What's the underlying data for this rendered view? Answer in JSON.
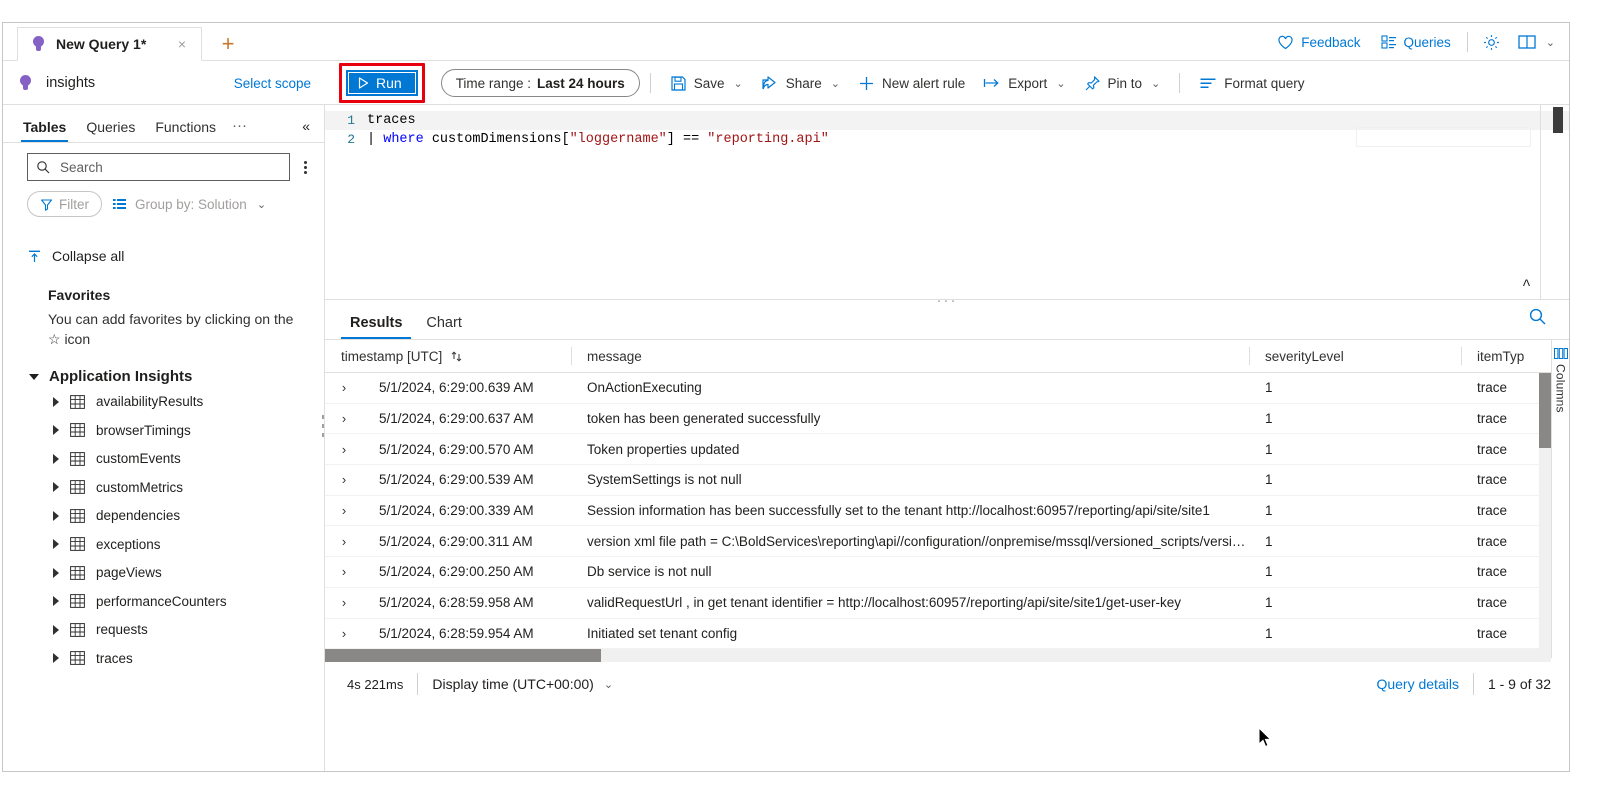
{
  "tab": {
    "title": "New Query 1*",
    "close_label": "×",
    "add_label": "+",
    "icon": "lightbulb-icon"
  },
  "header_right": {
    "feedback": "Feedback",
    "queries": "Queries",
    "settings_icon": "gear-icon",
    "layout_icon": "book-layout-icon",
    "layout_chevron": "⌄"
  },
  "scope": {
    "name": "insights",
    "select_scope": "Select scope",
    "icon": "lightbulb-icon"
  },
  "commandbar": {
    "run": "Run",
    "run_icon": "play-icon",
    "time_range_label": "Time range :",
    "time_range_value": "Last 24 hours",
    "save": "Save",
    "share": "Share",
    "new_alert_rule": "New alert rule",
    "export": "Export",
    "pin_to": "Pin to",
    "format_query": "Format query",
    "chevron": "⌄"
  },
  "left_panel": {
    "tabs": [
      {
        "label": "Tables",
        "active": true
      },
      {
        "label": "Queries",
        "active": false
      },
      {
        "label": "Functions",
        "active": false
      }
    ],
    "more_label": "···",
    "collapse_icon": "«",
    "search_placeholder": "Search",
    "search_value": "",
    "search_icon": "search-icon",
    "kebab_icon": "more-vertical-icon",
    "filter_label": "Filter",
    "filter_icon": "funnel-icon",
    "group_by_label": "Group by: Solution",
    "group_by_icon": "list-icon",
    "collapse_all": "Collapse all",
    "collapse_all_icon": "collapse-all-icon",
    "favorites_title": "Favorites",
    "favorites_hint": "You can add favorites by clicking on the ☆ icon",
    "group_title": "Application Insights",
    "tables": [
      "availabilityResults",
      "browserTimings",
      "customEvents",
      "customMetrics",
      "dependencies",
      "exceptions",
      "pageViews",
      "performanceCounters",
      "requests",
      "traces"
    ]
  },
  "editor": {
    "lines": [
      {
        "number": "1",
        "text": "traces"
      },
      {
        "number": "2",
        "text": "| where customDimensions[\"loggername\"] == \"reporting.api\""
      }
    ],
    "line2_tokens": {
      "pipe": "|",
      "keyword": "where",
      "identifier": " customDimensions[",
      "string1": "\"loggername\"",
      "bracket": "] ",
      "operator": "==",
      "string2": " \"reporting.api\""
    },
    "collapse_chevrons": "«"
  },
  "results": {
    "tabs": [
      {
        "label": "Results",
        "active": true
      },
      {
        "label": "Chart",
        "active": false
      }
    ],
    "search_icon": "search-icon",
    "columns_rail_label": "Columns",
    "columns_rail_icon": "columns-icon",
    "headers": [
      {
        "label": "timestamp [UTC]",
        "sort_icon": "sort-updown-icon"
      },
      {
        "label": "message",
        "sort_icon": ""
      },
      {
        "label": "severityLevel",
        "sort_icon": ""
      },
      {
        "label": "itemTyp",
        "sort_icon": ""
      }
    ],
    "expand_icon": "›",
    "rows": [
      {
        "timestamp": "5/1/2024, 6:29:00.639 AM",
        "message": "OnActionExecuting",
        "severityLevel": "1",
        "itemType": "trace"
      },
      {
        "timestamp": "5/1/2024, 6:29:00.637 AM",
        "message": "token has been generated successfully",
        "severityLevel": "1",
        "itemType": "trace"
      },
      {
        "timestamp": "5/1/2024, 6:29:00.570 AM",
        "message": "Token properties updated",
        "severityLevel": "1",
        "itemType": "trace"
      },
      {
        "timestamp": "5/1/2024, 6:29:00.539 AM",
        "message": "SystemSettings is not null",
        "severityLevel": "1",
        "itemType": "trace"
      },
      {
        "timestamp": "5/1/2024, 6:29:00.339 AM",
        "message": "Session information has been successfully set to the tenant http://localhost:60957/reporting/api/site/site1",
        "severityLevel": "1",
        "itemType": "trace"
      },
      {
        "timestamp": "5/1/2024, 6:29:00.311 AM",
        "message": "version xml file path = C:\\BoldServices\\reporting\\api//configuration//onpremise/mssql/versioned_scripts/versio…",
        "severityLevel": "1",
        "itemType": "trace"
      },
      {
        "timestamp": "5/1/2024, 6:29:00.250 AM",
        "message": "Db service is not null",
        "severityLevel": "1",
        "itemType": "trace"
      },
      {
        "timestamp": "5/1/2024, 6:28:59.958 AM",
        "message": "validRequestUrl , in get tenant identifier = http://localhost:60957/reporting/api/site/site1/get-user-key",
        "severityLevel": "1",
        "itemType": "trace"
      },
      {
        "timestamp": "5/1/2024, 6:28:59.954 AM",
        "message": "Initiated set tenant config",
        "severityLevel": "1",
        "itemType": "trace"
      }
    ]
  },
  "statusbar": {
    "duration": "4s 221ms",
    "display_time": "Display time (UTC+00:00)",
    "display_time_chevron": "⌄",
    "query_details": "Query details",
    "page_count": "1 - 9 of 32"
  },
  "colors": {
    "accent": "#0078d4",
    "highlight_border": "#e8000d",
    "bulb": "#8661c5"
  }
}
